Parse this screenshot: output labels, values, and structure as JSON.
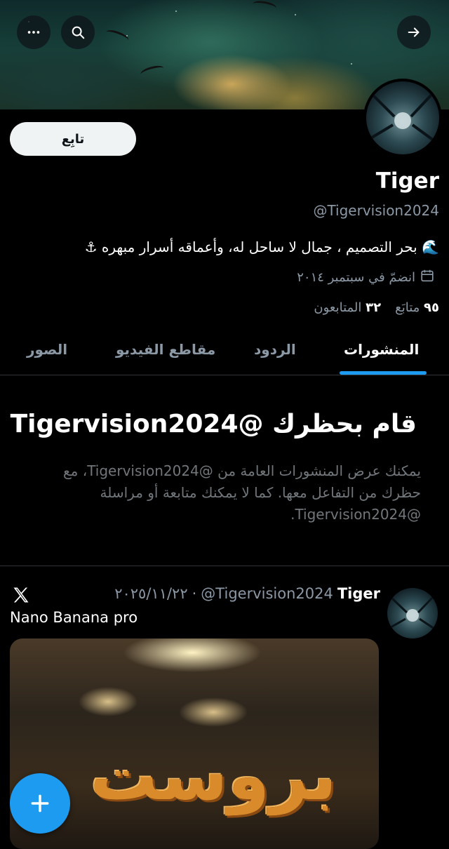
{
  "header": {
    "follow_label": "تابِع"
  },
  "profile": {
    "name": "Tiger",
    "handle": "@Tigervision2024",
    "bio": "🌊 بحر التصميم ، جمال لا ساحل له، وأعماقه أسرار مبهره ⚓",
    "joined": "انضمّ في سبتمبر ٢٠١٤",
    "following_count": "٩٥",
    "following_label": "متابَع",
    "followers_count": "٣٢",
    "followers_label": "المتابعون"
  },
  "tabs": [
    {
      "label": "المنشورات",
      "active": true
    },
    {
      "label": "الردود",
      "active": false
    },
    {
      "label": "مقاطع الفيديو",
      "active": false
    },
    {
      "label": "الصور",
      "active": false
    }
  ],
  "blocked": {
    "title": "قام بحظرك @Tigervision2024",
    "body": "يمكنك عرض المنشورات العامة من @Tigervision2024، مع حظرك من التفاعل معها. كما لا يمكنك متابعة أو مراسلة @Tigervision2024."
  },
  "tweet": {
    "author_name": "Tiger",
    "author_handle": "@Tigervision2024",
    "separator": "·",
    "date": "٢٠٢٥/١١/٢٢",
    "text": "Nano Banana pro",
    "media_text": "بروست"
  },
  "icons": {
    "more": "more-icon",
    "search": "search-icon",
    "back": "arrow-right-icon",
    "calendar": "calendar-icon",
    "x_logo": "x-logo-icon",
    "compose": "plus-icon"
  },
  "colors": {
    "accent": "#1d9bf0",
    "background": "#000000",
    "secondary_text": "#8b98a5"
  }
}
